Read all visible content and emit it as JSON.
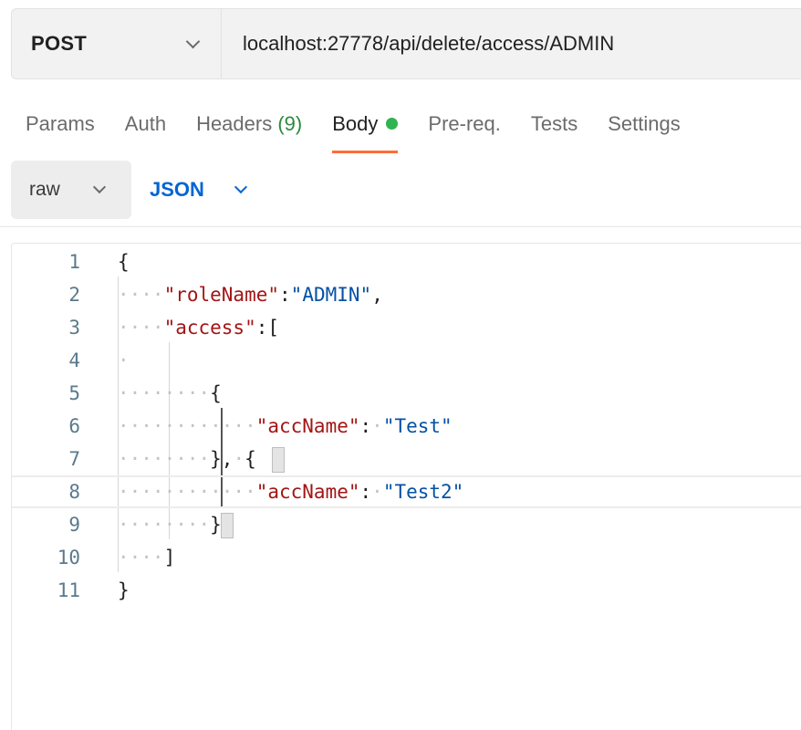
{
  "request": {
    "method": "POST",
    "url": "localhost:27778/api/delete/access/ADMIN"
  },
  "tabs": [
    {
      "label": "Params"
    },
    {
      "label": "Auth"
    },
    {
      "label": "Headers ",
      "count": "(9)"
    },
    {
      "label": "Body",
      "active": true
    },
    {
      "label": "Pre-req."
    },
    {
      "label": "Tests"
    },
    {
      "label": "Settings"
    }
  ],
  "body_options": {
    "mode": "raw",
    "language": "JSON"
  },
  "editor": {
    "line_numbers": [
      "1",
      "2",
      "3",
      "4",
      "5",
      "6",
      "7",
      "8",
      "9",
      "10",
      "11"
    ],
    "lines": [
      "{",
      "    \"roleName\":\"ADMIN\",",
      "    \"access\":[",
      "    ",
      "        {",
      "            \"accName\": \"Test\"",
      "        }, {",
      "            \"accName\": \"Test2\"",
      "        }",
      "    ]",
      "}"
    ]
  },
  "colors": {
    "accent": "#ff6c37",
    "json_blue": "#0265d2",
    "status_green": "#2fb350"
  }
}
